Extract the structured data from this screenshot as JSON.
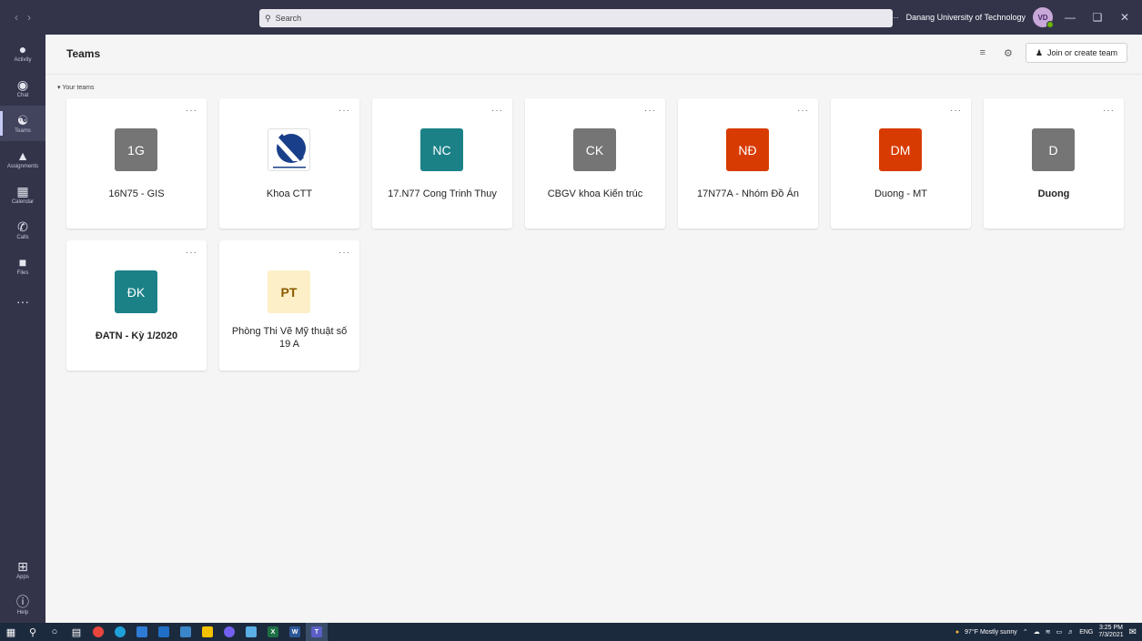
{
  "titlebar": {
    "search_placeholder": "Search",
    "more": "···",
    "org_name": "Danang University of Technology",
    "avatar_initials": "VD"
  },
  "rail": {
    "items": [
      {
        "label": "Activity",
        "icon": "bell-icon"
      },
      {
        "label": "Chat",
        "icon": "chat-icon"
      },
      {
        "label": "Teams",
        "icon": "teams-icon",
        "active": true
      },
      {
        "label": "Assignments",
        "icon": "assignments-icon"
      },
      {
        "label": "Calendar",
        "icon": "calendar-icon"
      },
      {
        "label": "Calls",
        "icon": "phone-icon"
      },
      {
        "label": "Files",
        "icon": "file-icon"
      }
    ],
    "more": "···",
    "apps_label": "Apps",
    "help_label": "Help"
  },
  "header": {
    "title": "Teams",
    "join_label": "Join or create team"
  },
  "section": {
    "label": "Your teams"
  },
  "teams": [
    {
      "initials": "1G",
      "name": "16N75 - GIS",
      "color": "#757575",
      "bold": false
    },
    {
      "initials": "",
      "name": "Khoa CTT",
      "color": "#ffffff",
      "bold": false,
      "logo": true
    },
    {
      "initials": "NC",
      "name": "17.N77 Cong Trinh Thuy",
      "color": "#1b8187",
      "bold": false
    },
    {
      "initials": "CK",
      "name": "CBGV khoa Kiến trúc",
      "color": "#757575",
      "bold": false
    },
    {
      "initials": "NĐ",
      "name": "17N77A - Nhóm Đồ Án",
      "color": "#d83b01",
      "bold": false
    },
    {
      "initials": "DM",
      "name": "Duong - MT",
      "color": "#d83b01",
      "bold": false
    },
    {
      "initials": "D",
      "name": "Duong",
      "color": "#757575",
      "bold": true
    },
    {
      "initials": "ĐK",
      "name": "ĐATN - Kỳ 1/2020",
      "color": "#1b8187",
      "bold": true
    },
    {
      "initials": "PT",
      "name": "Phòng Thi Vẽ Mỹ thuật số 19 A",
      "color": "#fdefc7",
      "text_color": "#8a5a00",
      "bold": false
    }
  ],
  "taskbar": {
    "weather": "97°F  Mostly sunny",
    "lang": "ENG",
    "time": "3:25 PM",
    "date": "7/3/2021"
  }
}
